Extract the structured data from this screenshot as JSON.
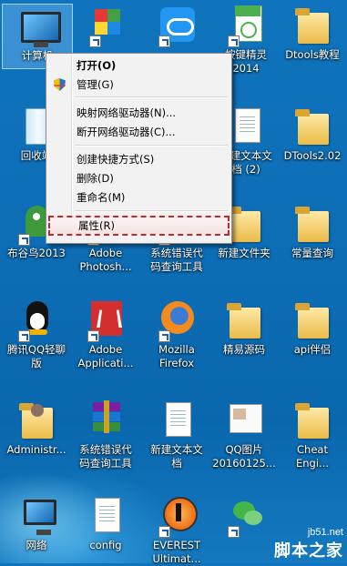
{
  "desktop": {
    "icons": [
      {
        "label": "计算机"
      },
      {
        "label": ""
      },
      {
        "label": ""
      },
      {
        "label": "按键精灵\n2014"
      },
      {
        "label": "Dtools教程"
      },
      {
        "label": "回收站"
      },
      {
        "label": "新建文本文\n档 (2)"
      },
      {
        "label": "DTools2.02"
      },
      {
        "label": "布谷鸟2013"
      },
      {
        "label": "Adobe\nPhotosh..."
      },
      {
        "label": "系统错误代\n码查询工具"
      },
      {
        "label": "新建文件夹"
      },
      {
        "label": "常量查询"
      },
      {
        "label": "腾讯QQ轻聊\n版"
      },
      {
        "label": "Adobe\nApplicati..."
      },
      {
        "label": "Mozilla\nFirefox"
      },
      {
        "label": "精易源码"
      },
      {
        "label": "api伴侣"
      },
      {
        "label": "Administr..."
      },
      {
        "label": "系统错误代\n码查询工具"
      },
      {
        "label": "新建文本文\n档"
      },
      {
        "label": "QQ图片\n20160125..."
      },
      {
        "label": "Cheat\nEngi..."
      },
      {
        "label": "网络"
      },
      {
        "label": "config"
      },
      {
        "label": "EVEREST\nUltimat..."
      }
    ]
  },
  "context_menu": {
    "open": "打开(O)",
    "manage": "管理(G)",
    "map_drive": "映射网络驱动器(N)...",
    "disconnect_drive": "断开网络驱动器(C)...",
    "create_shortcut": "创建快捷方式(S)",
    "delete": "删除(D)",
    "rename": "重命名(M)",
    "properties": "属性(R)"
  },
  "watermark": {
    "url": "jb51.net",
    "name": "脚本之家"
  },
  "colors": {
    "highlight_border": "#c1272d",
    "desktop_blue": "#0d6eb6"
  }
}
